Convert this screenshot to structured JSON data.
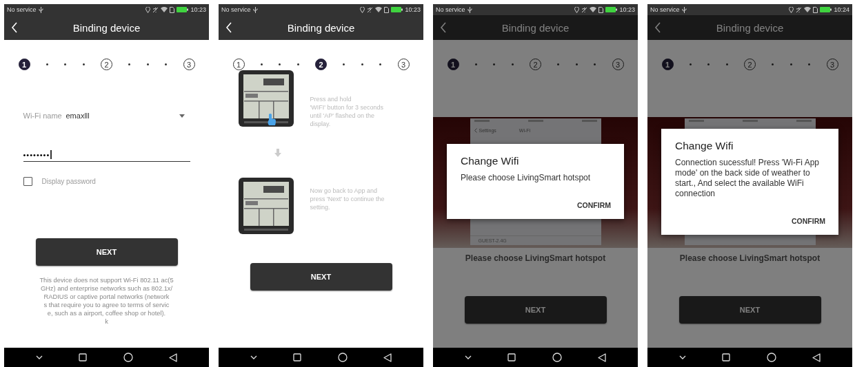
{
  "screens": [
    {
      "kind": "form",
      "status": {
        "carrier": "No service",
        "time": "10:23"
      },
      "title": "Binding device",
      "steps": [
        {
          "label": "1",
          "selected": true
        },
        {
          "label": "2",
          "selected": false
        },
        {
          "label": "3",
          "selected": false
        }
      ],
      "wifi_label": "Wi-Fi name",
      "wifi_value": "emaxlll",
      "password_value": "••••••••",
      "checkbox": {
        "label": "Display password",
        "checked": false
      },
      "button": "NEXT",
      "footnote": "This device does not support Wi-Fi 802.11 ac(5\nGHz) and enterprise networks such as 802.1x/\nRADIUS or captive portal networks (network\ns that require you to agree to terms of servic\ne, such as a airport, coffee shop or hotel).\nk"
    },
    {
      "kind": "instructions",
      "status": {
        "carrier": "No service",
        "time": "10:23"
      },
      "title": "Binding device",
      "steps": [
        {
          "label": "1",
          "selected": false
        },
        {
          "label": "2",
          "selected": true
        },
        {
          "label": "3",
          "selected": false
        }
      ],
      "items": [
        {
          "text": "Press and hold\n'WIFI' button for 3 seconds\nuntil 'AP' flashed on the\ndisplay.",
          "pointer": true
        },
        {
          "text": "Now go back to App and\npress 'Next' to continue the\nsetting.",
          "pointer": false
        }
      ],
      "button": "NEXT"
    },
    {
      "kind": "dialog",
      "status": {
        "carrier": "No service",
        "time": "10:23"
      },
      "title": "Binding device",
      "steps": [
        {
          "label": "1",
          "selected": true
        },
        {
          "label": "2",
          "selected": false
        },
        {
          "label": "3",
          "selected": false
        }
      ],
      "hero": {
        "back_label": "Settings",
        "header": "Wi-Fi",
        "network": "GUEST-2.4G"
      },
      "caption": "Please choose LivingSmart hotspot",
      "button": "NEXT",
      "dialog": {
        "title": "Change Wifi",
        "message": "Please choose LivingSmart hotspot",
        "button": "CONFIRM"
      }
    },
    {
      "kind": "dialog",
      "status": {
        "carrier": "No service",
        "time": "10:24"
      },
      "title": "Binding device",
      "steps": [
        {
          "label": "1",
          "selected": true
        },
        {
          "label": "2",
          "selected": false
        },
        {
          "label": "3",
          "selected": false
        }
      ],
      "caption": "Please choose LivingSmart hotspot",
      "button": "NEXT",
      "dialog": {
        "title": "Change Wifi",
        "message": "Connection sucessful! Press 'Wi-Fi App mode' on the back side of weather to start., And select the available WiFi connection",
        "button": "CONFIRM"
      }
    }
  ]
}
